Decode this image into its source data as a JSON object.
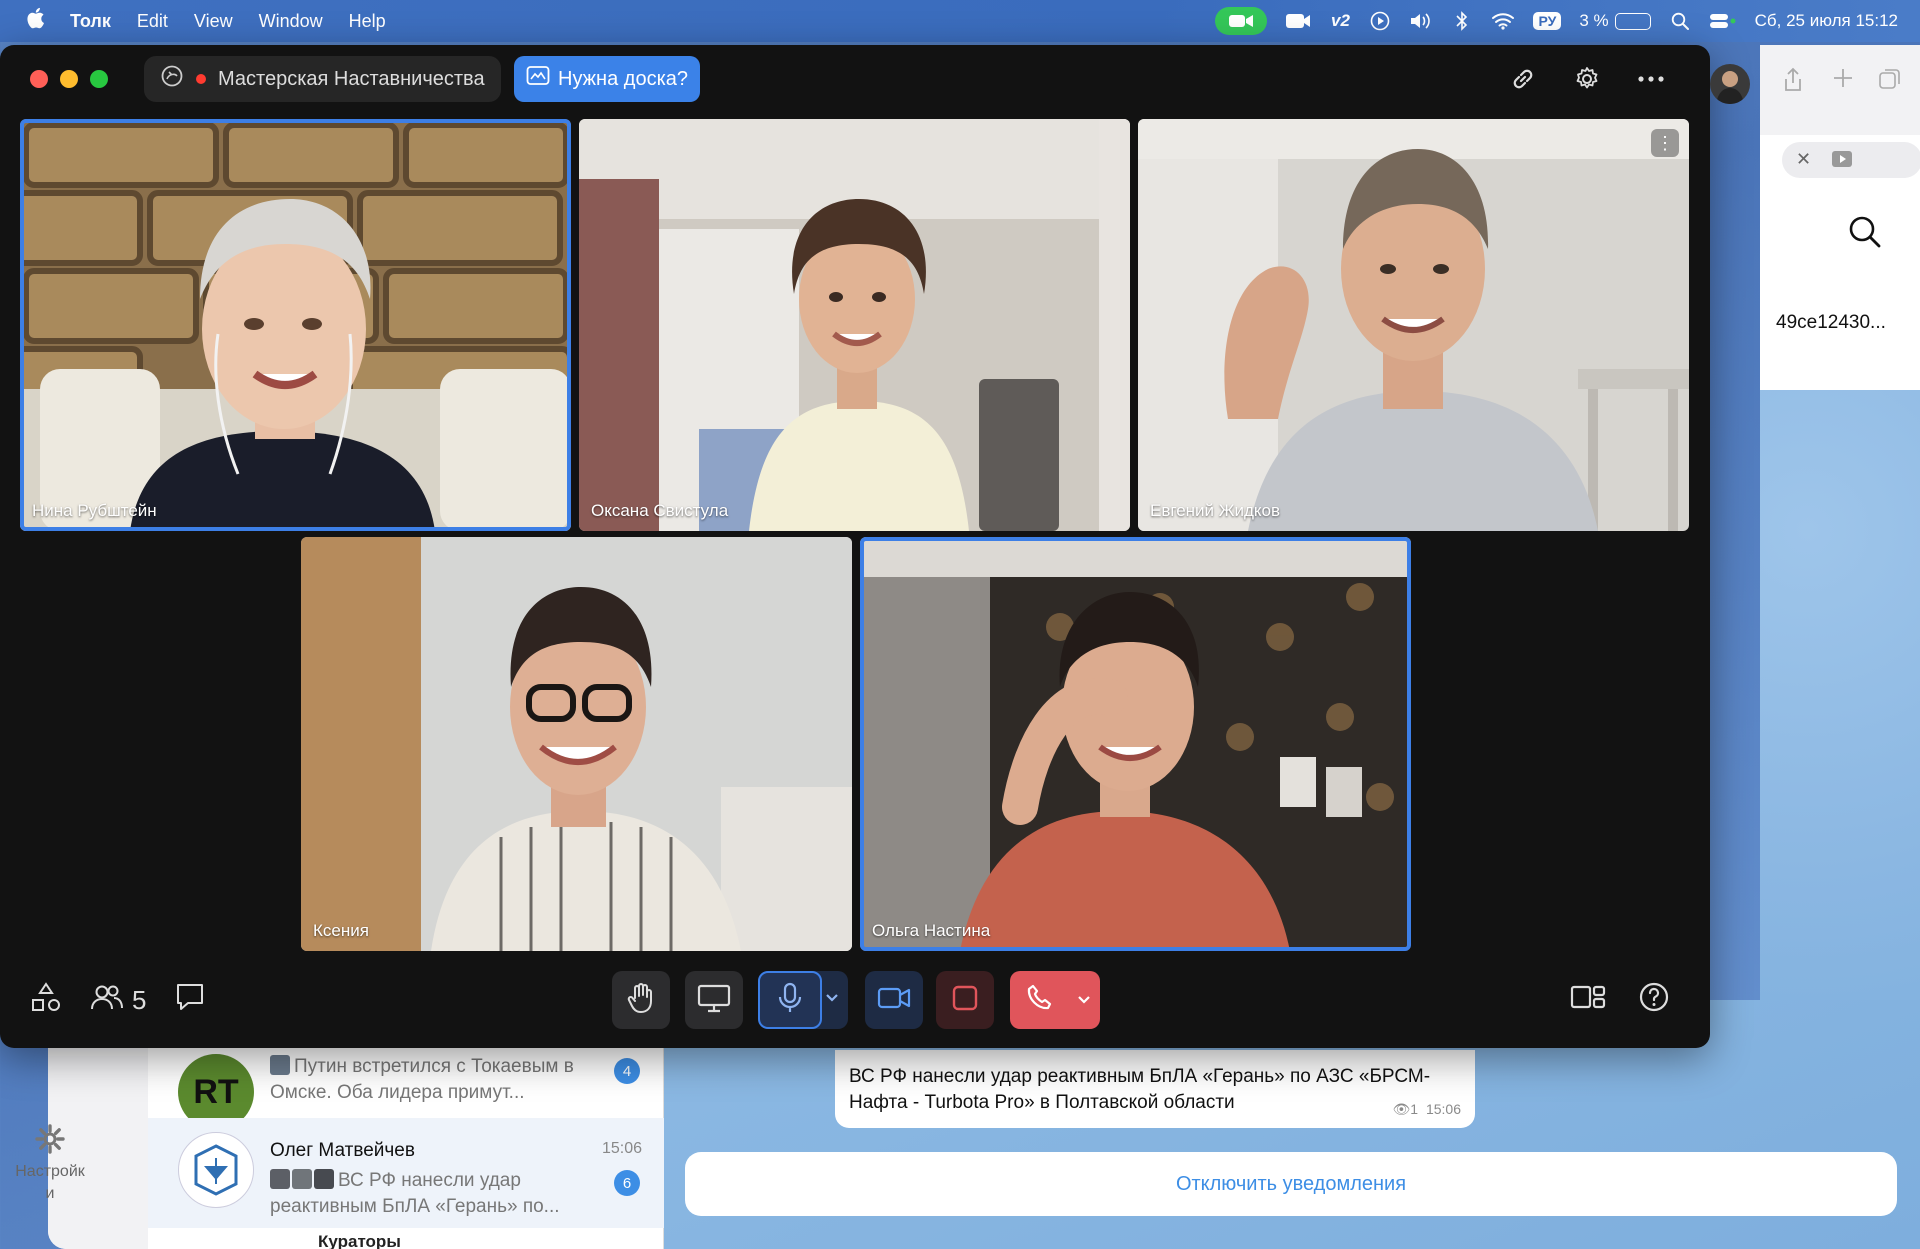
{
  "menubar": {
    "app_name": "Толк",
    "menus": [
      "Edit",
      "View",
      "Window",
      "Help"
    ],
    "vpn_label": "v2",
    "lang": "РУ",
    "battery": "3 %",
    "battery_level_percent": 3,
    "datetime": "Сб, 25 июля 15:12"
  },
  "call": {
    "room_name": "Мастерская Наставничества",
    "whiteboard_button": "Нужна доска?",
    "participants_count": "5",
    "participants": [
      {
        "name": "Нина Рубштейн",
        "active": true
      },
      {
        "name": "Оксана Свистула",
        "active": false
      },
      {
        "name": "Евгений Жидков",
        "active": false
      },
      {
        "name": "Ксения",
        "active": false
      },
      {
        "name": "Ольга Настина",
        "active": true
      }
    ]
  },
  "background_window": {
    "hash_text": "49ce12430..."
  },
  "chat": {
    "settings_label": "Настройки",
    "list": [
      {
        "avatar_text": "RT",
        "name": "",
        "time": "",
        "preview": "Путин встретился с Токаевым в Омске. Оба лидера примут...",
        "badge": "4"
      },
      {
        "avatar_text": "",
        "name": "Олег Матвейчев",
        "time": "15:06",
        "preview": "ВС РФ нанесли удар реактивным БпЛА «Герань» по...",
        "badge": "6"
      }
    ],
    "section_label": "Кураторы",
    "message_text": "ВС РФ нанесли удар реактивным БпЛА «Герань» по АЗС «БРСМ-Нафта - Turbota Pro» в Полтавской области",
    "message_views": "1",
    "message_time": "15:06",
    "mute_button": "Отключить уведомления"
  },
  "colors": {
    "accent": "#3d7fe6",
    "hangup": "#e0555b",
    "menubar": "#3a6cbd",
    "call_bg": "#121212"
  }
}
